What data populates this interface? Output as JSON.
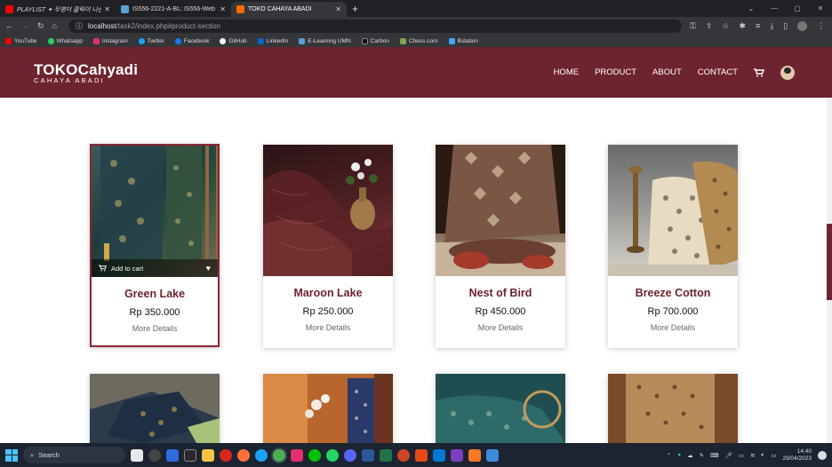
{
  "browser": {
    "tabs": [
      {
        "label": "PLAYLIST ✦ 무명이 클릭이 나슨",
        "favicon_color": "#ff0000"
      },
      {
        "label": "IS556-2221-A-BL: IS556-Web De",
        "favicon_color": "#5aa0d0"
      },
      {
        "label": "TOKO CAHAYA ABADI",
        "favicon_color": "#ff6a00"
      }
    ],
    "new_tab": "+",
    "url_host": "localhost",
    "url_path": "/task2/index.php#product-section",
    "bookmarks": [
      {
        "label": "YouTube",
        "color": "#ff0000"
      },
      {
        "label": "Whatsapp",
        "color": "#25d366"
      },
      {
        "label": "Instagram",
        "color": "#e1306c"
      },
      {
        "label": "Twitter",
        "color": "#1da1f2"
      },
      {
        "label": "Facebook",
        "color": "#1877f2"
      },
      {
        "label": "GitHub",
        "color": "#ffffff"
      },
      {
        "label": "LinkedIn",
        "color": "#0a66c2"
      },
      {
        "label": "E-Learning UMN",
        "color": "#5aa0d0"
      },
      {
        "label": "Carbon",
        "color": "#333333"
      },
      {
        "label": "Chess.com",
        "color": "#7fa650"
      },
      {
        "label": "Bstation",
        "color": "#4aa5ff"
      }
    ]
  },
  "site": {
    "logo_main": "TOKOCahyadi",
    "logo_sub": "CAHAYA ABADI",
    "nav": [
      "HOME",
      "PRODUCT",
      "ABOUT",
      "CONTACT"
    ],
    "brand_color": "#6e2430"
  },
  "products": [
    {
      "name": "Green Lake",
      "price": "Rp 350.000",
      "details": "More Details",
      "add_to_cart": "Add to cart"
    },
    {
      "name": "Maroon Lake",
      "price": "Rp 250.000",
      "details": "More Details"
    },
    {
      "name": "Nest of Bird",
      "price": "Rp 450.000",
      "details": "More Details"
    },
    {
      "name": "Breeze Cotton",
      "price": "Rp 700.000",
      "details": "More Details"
    }
  ],
  "taskbar": {
    "search_placeholder": "Search",
    "time": "14:40",
    "date": "29/04/2023"
  }
}
